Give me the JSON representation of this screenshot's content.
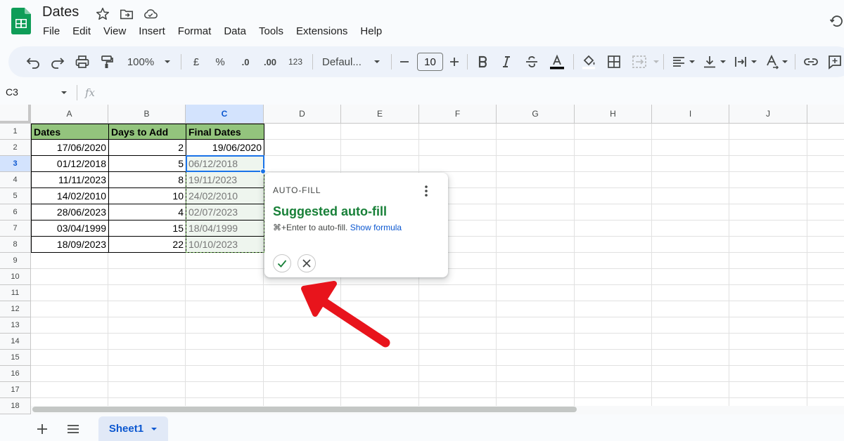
{
  "app": {
    "title": "Dates"
  },
  "menu": [
    "File",
    "Edit",
    "View",
    "Insert",
    "Format",
    "Data",
    "Tools",
    "Extensions",
    "Help"
  ],
  "toolbar": {
    "zoom": "100%",
    "currency": "£",
    "percent": "%",
    "decrease_decimals": ".0",
    "increase_decimals": ".00",
    "format_more": "123",
    "font_family": "Defaul...",
    "font_size": "10"
  },
  "formula_bar": {
    "name_box": "C3",
    "fx": "fx"
  },
  "grid": {
    "columns": [
      "A",
      "B",
      "C",
      "D",
      "E",
      "F",
      "G",
      "H",
      "I",
      "J"
    ],
    "rows": [
      "1",
      "2",
      "3",
      "4",
      "5",
      "6",
      "7",
      "8",
      "9",
      "10",
      "11",
      "12",
      "13",
      "14",
      "15",
      "16",
      "17",
      "18"
    ],
    "selected_column": "C",
    "selected_row": "3",
    "headers": [
      "Dates",
      "Days to Add",
      "Final Dates"
    ],
    "data": [
      [
        "17/06/2020",
        "2",
        "19/06/2020"
      ],
      [
        "01/12/2018",
        "5",
        "06/12/2018"
      ],
      [
        "11/11/2023",
        "8",
        "19/11/2023"
      ],
      [
        "14/02/2010",
        "10",
        "24/02/2010"
      ],
      [
        "28/06/2023",
        "4",
        "02/07/2023"
      ],
      [
        "03/04/1999",
        "15",
        "18/04/1999"
      ],
      [
        "18/09/2023",
        "22",
        "10/10/2023"
      ]
    ]
  },
  "popup": {
    "label": "AUTO-FILL",
    "title": "Suggested auto-fill",
    "hint": "⌘+Enter to auto-fill.",
    "link": "Show formula"
  },
  "sheets": {
    "active": "Sheet1"
  },
  "colors": {
    "header_fill": "#93c47d",
    "accent": "#1a73e8",
    "suggest_green": "#188038",
    "annotation_arrow": "#e8141c"
  }
}
